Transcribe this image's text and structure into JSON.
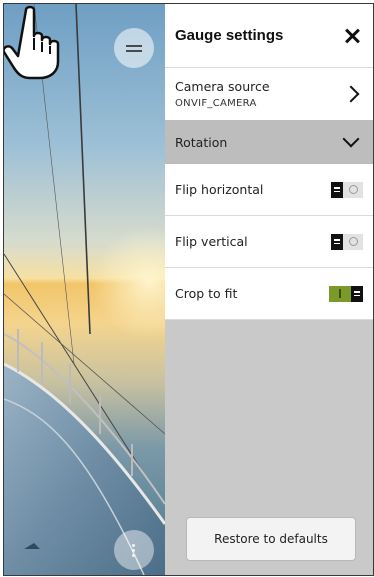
{
  "panel": {
    "title": "Gauge settings",
    "camera_source": {
      "label": "Camera source",
      "value": "ONVIF_CAMERA"
    },
    "rotation_section": {
      "label": "Rotation",
      "expanded": true
    },
    "options": [
      {
        "label": "Flip horizontal",
        "enabled": false
      },
      {
        "label": "Flip vertical",
        "enabled": false
      },
      {
        "label": "Crop to fit",
        "enabled": true
      }
    ],
    "restore_button": "Restore to defaults"
  },
  "icons": {
    "close": "close-icon",
    "menu": "hamburger-menu-icon",
    "more": "more-vertical-icon",
    "pointer": "hand-pointer-cursor"
  },
  "colors": {
    "toggle_on": "#7a9a2a",
    "toggle_off": "#e2e2e2",
    "panel_bg": "#c9c9c9"
  }
}
